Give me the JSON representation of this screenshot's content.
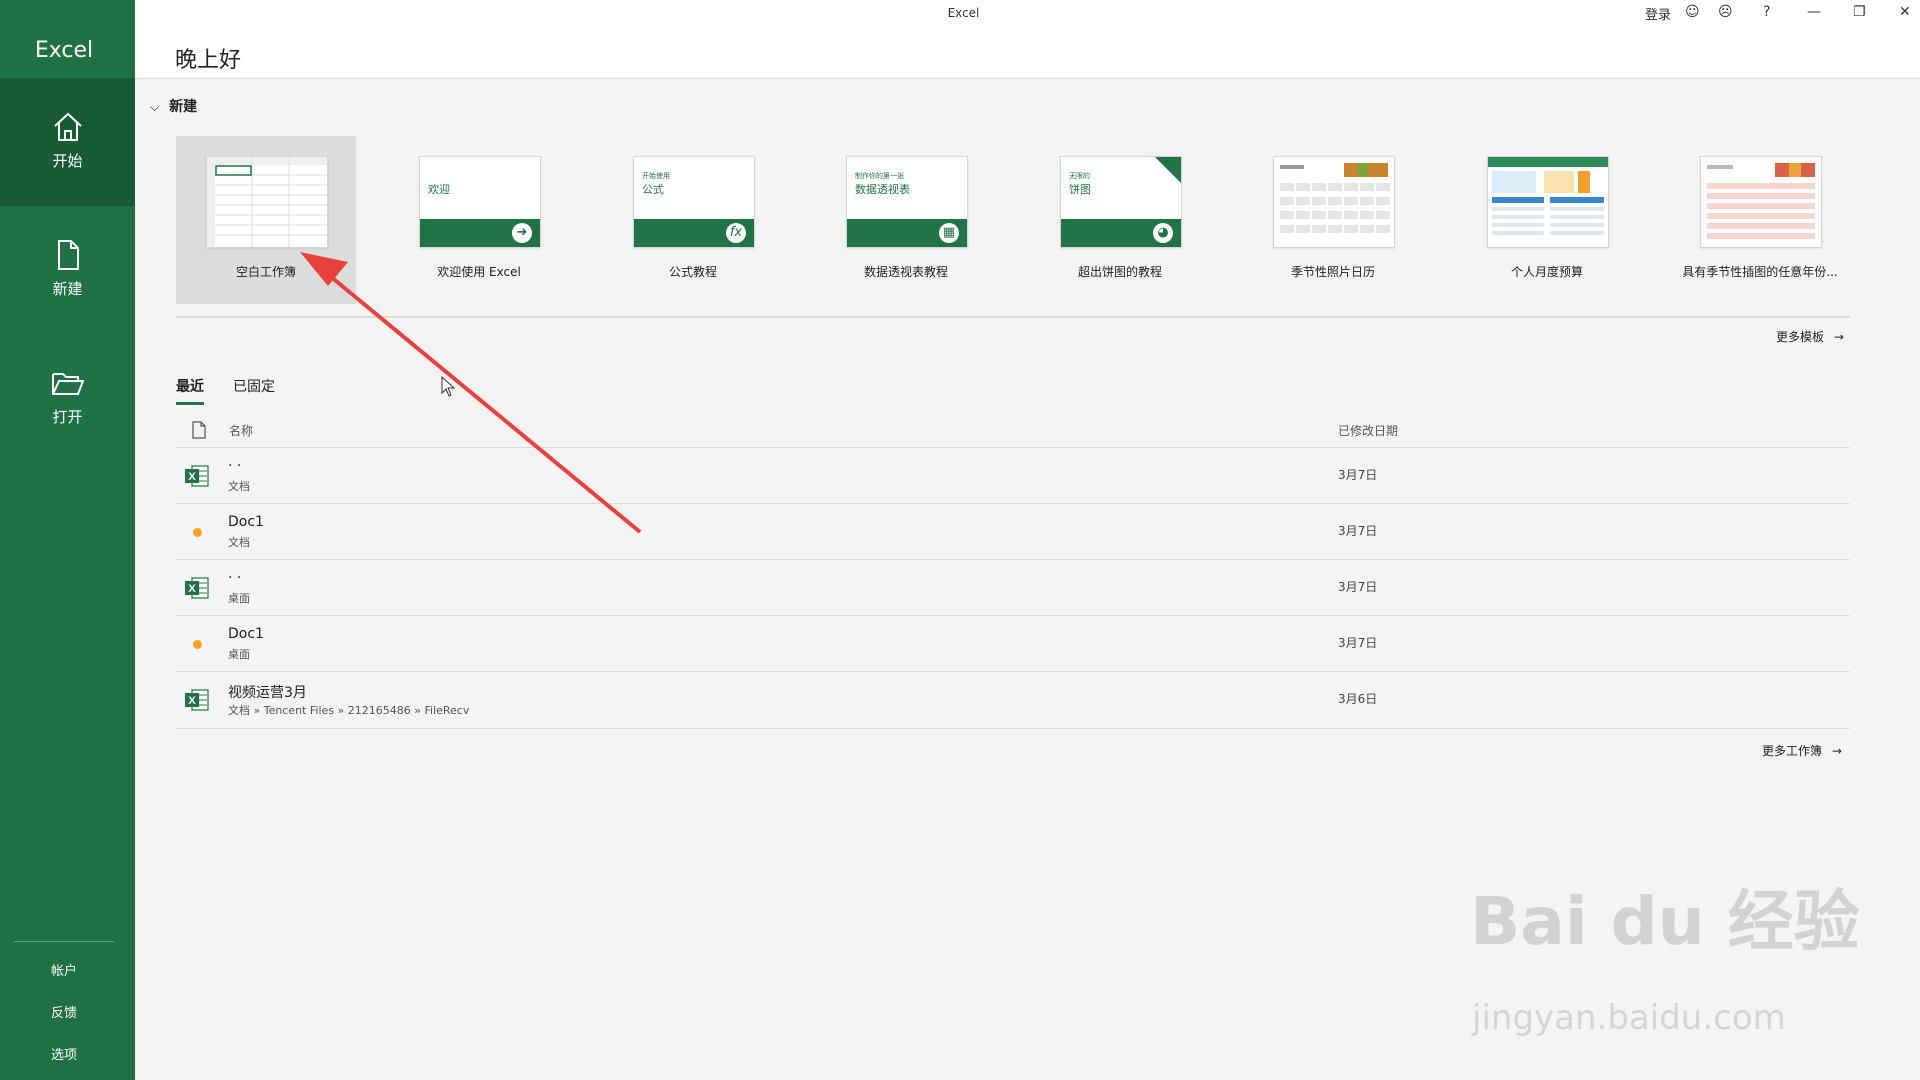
{
  "app": {
    "name": "Excel",
    "window_title": "Excel"
  },
  "header": {
    "greeting": "晚上好"
  },
  "titlebar": {
    "signin": "登录",
    "help": "?"
  },
  "sidebar": {
    "items": [
      {
        "label": "开始",
        "icon": "home-icon"
      },
      {
        "label": "新建",
        "icon": "new-file-icon"
      },
      {
        "label": "打开",
        "icon": "folder-icon"
      }
    ],
    "bottom": [
      "帐户",
      "反馈",
      "选项"
    ]
  },
  "new_section": {
    "title": "新建",
    "templates": [
      {
        "label": "空白工作簿",
        "thumb_title": "",
        "thumb_sub": ""
      },
      {
        "label": "欢迎使用 Excel",
        "thumb_title": "欢迎",
        "thumb_sub": ""
      },
      {
        "label": "公式教程",
        "thumb_title": "公式",
        "thumb_sub": "开始使用"
      },
      {
        "label": "数据透视表教程",
        "thumb_title": "数据透视表",
        "thumb_sub": "制作你的第一张"
      },
      {
        "label": "超出饼图的教程",
        "thumb_title": "饼图",
        "thumb_sub": "无限的"
      },
      {
        "label": "季节性照片日历",
        "thumb_title": "",
        "thumb_sub": ""
      },
      {
        "label": "个人月度预算",
        "thumb_title": "",
        "thumb_sub": ""
      },
      {
        "label": "具有季节性插图的任意年份...",
        "thumb_title": "",
        "thumb_sub": ""
      }
    ],
    "more_templates": "更多模板"
  },
  "recent": {
    "tabs": [
      "最近",
      "已固定"
    ],
    "columns": {
      "name": "名称",
      "date": "已修改日期"
    },
    "files": [
      {
        "name": "· ·",
        "path": "文档",
        "date": "3月7日",
        "type": "excel"
      },
      {
        "name": "Doc1",
        "path": "文档",
        "date": "3月7日",
        "type": "doc"
      },
      {
        "name": "· ·",
        "path": "桌面",
        "date": "3月7日",
        "type": "excel"
      },
      {
        "name": "Doc1",
        "path": "桌面",
        "date": "3月7日",
        "type": "doc"
      },
      {
        "name": "视频运营3月",
        "path": "文档 » Tencent Files » 212165486 » FileRecv",
        "date": "3月6日",
        "type": "excel"
      }
    ],
    "more_workbooks": "更多工作簿"
  },
  "watermark": {
    "brand": "Bai du 经验",
    "url": "jingyan.baidu.com"
  },
  "colors": {
    "accent": "#217346",
    "sidebar": "#207245",
    "sidebar_active": "#185c37",
    "arrow": "#e8413c"
  }
}
